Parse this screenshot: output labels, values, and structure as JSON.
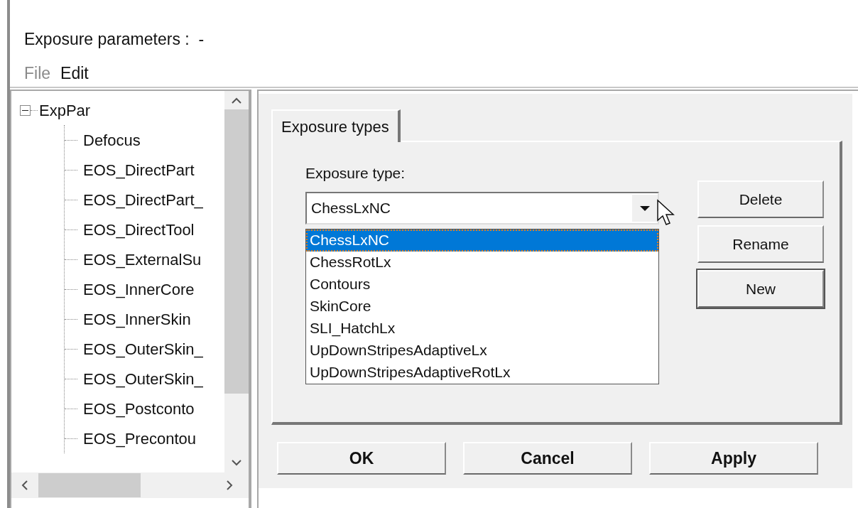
{
  "window": {
    "title": "Exposure parameters :  -"
  },
  "menu": [
    {
      "label": "File",
      "disabled": true
    },
    {
      "label": "Edit",
      "disabled": false
    }
  ],
  "tree": {
    "label": "ExpPar",
    "expanded": true,
    "children": [
      {
        "label": "Defocus"
      },
      {
        "label": "EOS_DirectPart"
      },
      {
        "label": "EOS_DirectPart_"
      },
      {
        "label": "EOS_DirectTool"
      },
      {
        "label": "EOS_ExternalSu"
      },
      {
        "label": "EOS_InnerCore"
      },
      {
        "label": "EOS_InnerSkin"
      },
      {
        "label": "EOS_OuterSkin_"
      },
      {
        "label": "EOS_OuterSkin_"
      },
      {
        "label": "EOS_Postconto"
      },
      {
        "label": "EOS_Precontou"
      }
    ]
  },
  "tabs": [
    {
      "label": "Exposure types",
      "selected": true
    }
  ],
  "exposure_type": {
    "label": "Exposure type:",
    "value": "ChessLxNC",
    "expanded": true,
    "options": [
      {
        "label": "ChessLxNC",
        "selected": true
      },
      {
        "label": "ChessRotLx",
        "selected": false
      },
      {
        "label": "Contours",
        "selected": false
      },
      {
        "label": "SkinCore",
        "selected": false
      },
      {
        "label": "SLI_HatchLx",
        "selected": false
      },
      {
        "label": "UpDownStripesAdaptiveLx",
        "selected": false
      },
      {
        "label": "UpDownStripesAdaptiveRotLx",
        "selected": false
      }
    ]
  },
  "side_buttons": [
    {
      "label": "Delete",
      "default": false
    },
    {
      "label": "Rename",
      "default": false
    },
    {
      "label": "New",
      "default": true
    }
  ],
  "dialog_buttons": [
    {
      "label": "OK"
    },
    {
      "label": "Cancel"
    },
    {
      "label": "Apply"
    }
  ]
}
